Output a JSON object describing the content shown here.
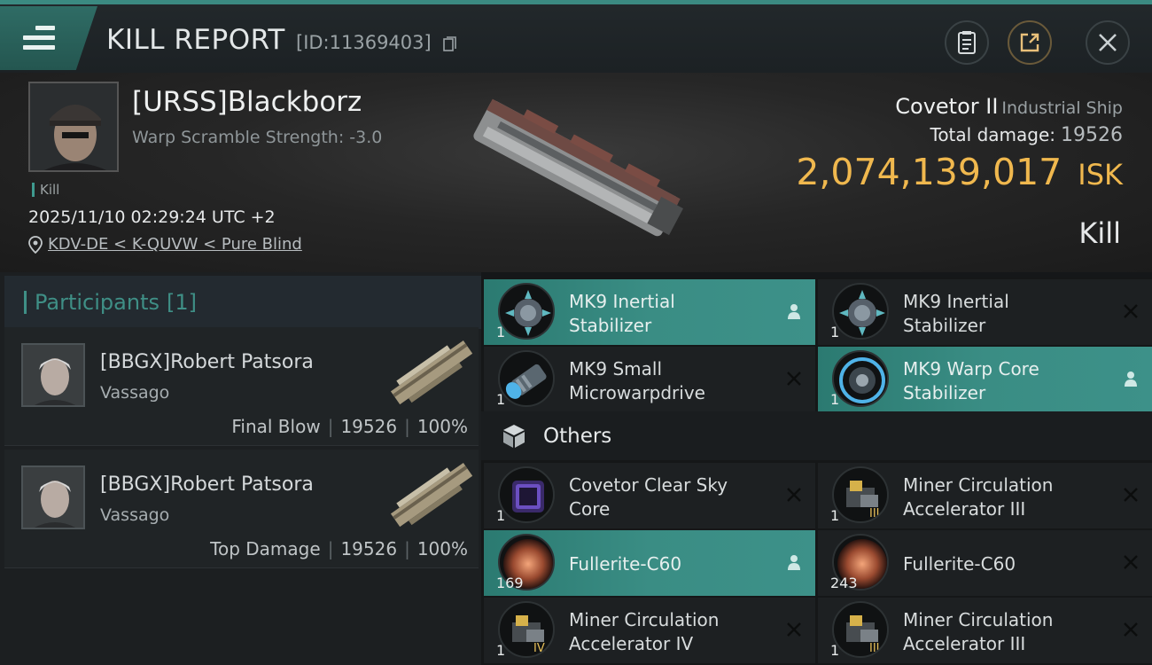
{
  "header": {
    "title": "KILL REPORT",
    "report_id": "[ID:11369403]"
  },
  "victim": {
    "name": "[URSS]Blackborz",
    "warp_scramble": "Warp Scramble Strength: -3.0",
    "kill_tag": "Kill",
    "timestamp": "2025/11/10 02:29:24 UTC +2",
    "location": "KDV-DE < K-QUVW < Pure Blind",
    "ship_name": "Covetor II",
    "ship_class": "Industrial Ship",
    "total_damage_label": "Total damage:",
    "total_damage": "19526",
    "isk_value": "2,074,139,017",
    "isk_unit": "ISK",
    "result": "Kill"
  },
  "participants": {
    "title": "Participants",
    "count": "[1]",
    "list": [
      {
        "name": "[BBGX]Robert Patsora",
        "ship": "Vassago",
        "role": "Final Blow",
        "damage": "19526",
        "percent": "100%"
      },
      {
        "name": "[BBGX]Robert Patsora",
        "ship": "Vassago",
        "role": "Top Damage",
        "damage": "19526",
        "percent": "100%"
      }
    ]
  },
  "modules": [
    {
      "name_1": "MK9 Inertial",
      "name_2": "Stabilizer",
      "qty": "1",
      "status": "dropped"
    },
    {
      "name_1": "MK9 Inertial",
      "name_2": "Stabilizer",
      "qty": "1",
      "status": "destroyed"
    },
    {
      "name_1": "MK9 Small",
      "name_2": "Microwarpdrive",
      "qty": "1",
      "status": "destroyed"
    },
    {
      "name_1": "MK9 Warp Core",
      "name_2": "Stabilizer",
      "qty": "1",
      "status": "dropped"
    }
  ],
  "others": {
    "title": "Others",
    "items": [
      {
        "name_1": "Covetor Clear Sky",
        "name_2": "Core",
        "qty": "1",
        "status": "destroyed",
        "tier": ""
      },
      {
        "name_1": "Miner Circulation",
        "name_2": "Accelerator III",
        "qty": "1",
        "status": "destroyed",
        "tier": "III"
      },
      {
        "name_1": "Fullerite-C60",
        "name_2": "",
        "qty": "169",
        "status": "dropped",
        "tier": ""
      },
      {
        "name_1": "Fullerite-C60",
        "name_2": "",
        "qty": "243",
        "status": "destroyed",
        "tier": ""
      },
      {
        "name_1": "Miner Circulation",
        "name_2": "Accelerator IV",
        "qty": "1",
        "status": "destroyed",
        "tier": "IV"
      },
      {
        "name_1": "Miner Circulation",
        "name_2": "Accelerator III",
        "qty": "1",
        "status": "destroyed",
        "tier": "III"
      }
    ]
  },
  "colors": {
    "accent_teal": "#3a8d84",
    "isk_gold": "#f0b84e"
  }
}
